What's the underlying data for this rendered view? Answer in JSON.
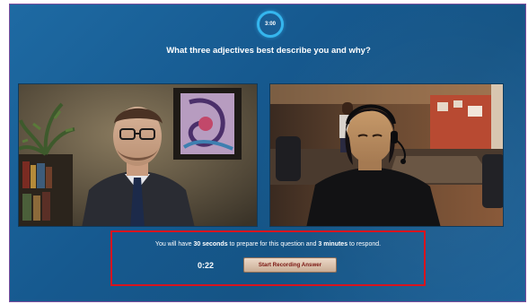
{
  "timer": {
    "label": "3:00"
  },
  "question": {
    "text": "What three adjectives best describe you and why?"
  },
  "videos": {
    "left": {
      "scene": "interviewer-feed"
    },
    "right": {
      "scene": "candidate-feed"
    }
  },
  "instructions": {
    "prefix": "You will have ",
    "prep_time": "30 seconds",
    "middle": " to prepare for this question and ",
    "answer_time": "3 minutes",
    "suffix": " to respond."
  },
  "countdown": {
    "value": "0:22"
  },
  "record_button": {
    "label": "Start Recording Answer"
  },
  "colors": {
    "background": "#16598f",
    "timer_ring": "#35b6ee",
    "highlight_box": "#d8141e",
    "button_text": "#7a1410"
  }
}
